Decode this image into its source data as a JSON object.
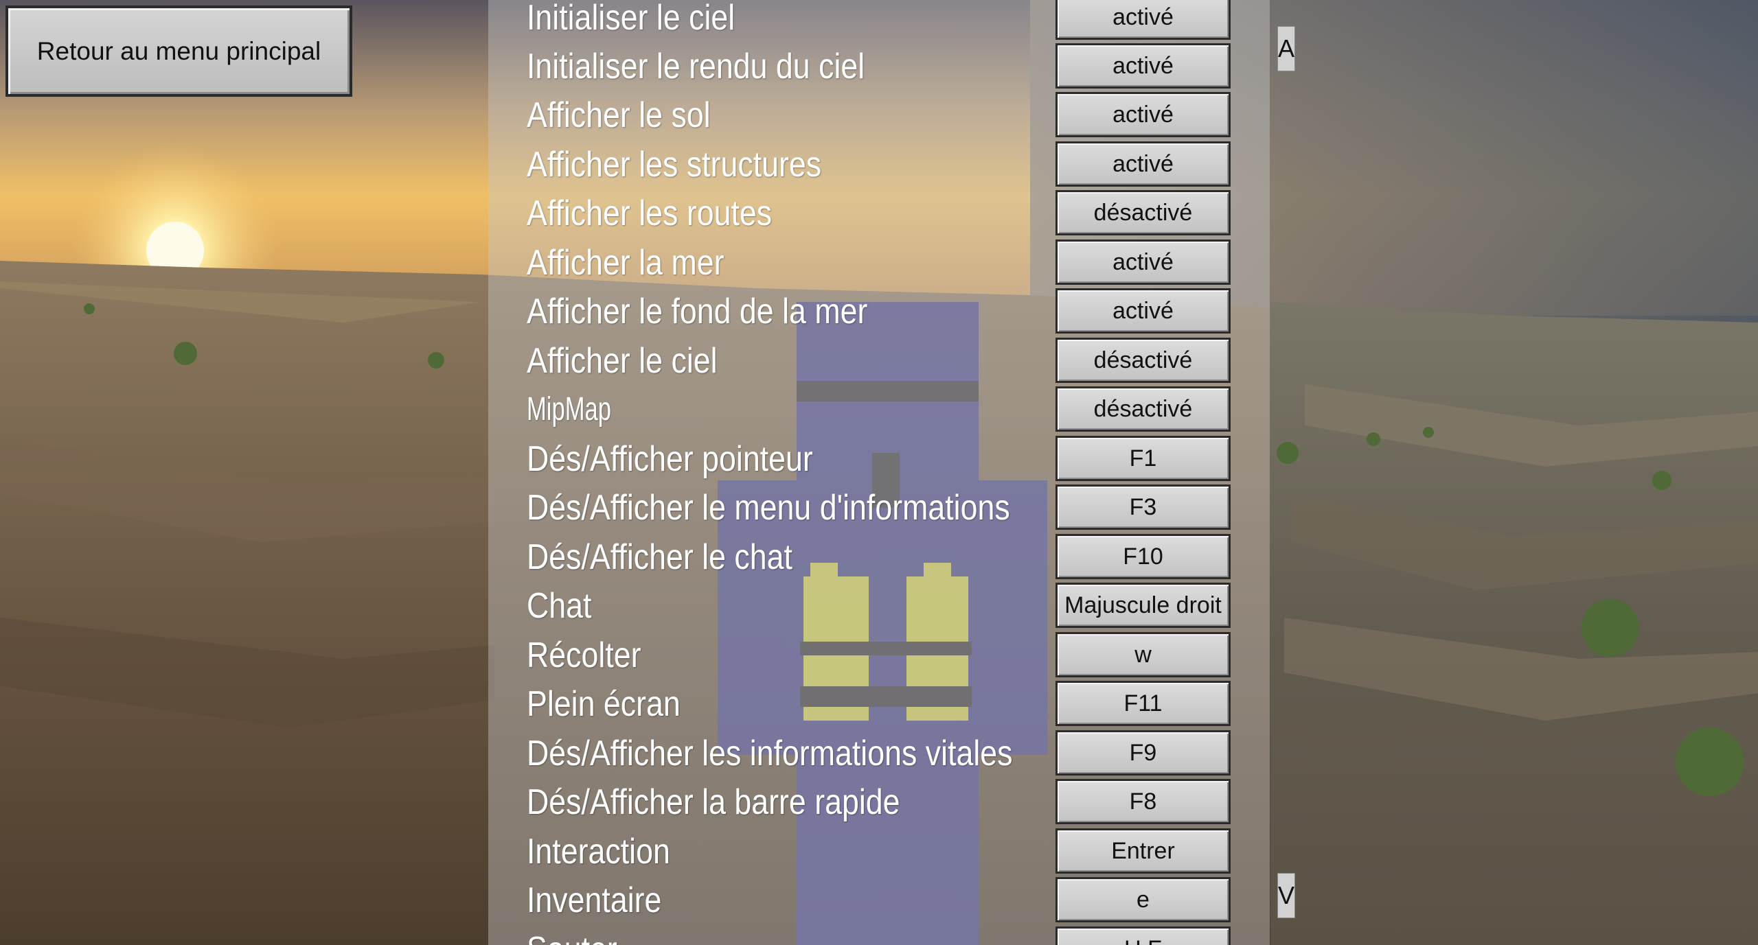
{
  "back_button": {
    "label": "Retour au menu principal"
  },
  "settings": [
    {
      "label": "Initialiser le ciel",
      "value": "activé"
    },
    {
      "label": "Initialiser le rendu du ciel",
      "value": "activé"
    },
    {
      "label": "Afficher le sol",
      "value": "activé"
    },
    {
      "label": "Afficher les structures",
      "value": "activé"
    },
    {
      "label": "Afficher les routes",
      "value": "désactivé"
    },
    {
      "label": "Afficher la mer",
      "value": "activé"
    },
    {
      "label": "Afficher le fond de la mer",
      "value": "activé"
    },
    {
      "label": "Afficher le ciel",
      "value": "désactivé"
    },
    {
      "label": "MipMap",
      "value": "désactivé"
    },
    {
      "label": "Dés/Afficher pointeur",
      "value": "F1"
    },
    {
      "label": "Dés/Afficher le menu d'informations",
      "value": "F3"
    },
    {
      "label": "Dés/Afficher le chat",
      "value": "F10"
    },
    {
      "label": "Chat",
      "value": "Majuscule droit"
    },
    {
      "label": "Récolter",
      "value": "w"
    },
    {
      "label": "Plein écran",
      "value": "F11"
    },
    {
      "label": "Dés/Afficher les informations vitales",
      "value": "F9"
    },
    {
      "label": "Dés/Afficher la barre rapide",
      "value": "F8"
    },
    {
      "label": "Interaction",
      "value": "Entrer"
    },
    {
      "label": "Inventaire",
      "value": "e"
    },
    {
      "label": "Sauter",
      "value": "U F"
    }
  ],
  "scrollbar": {
    "up_label": "A",
    "down_label": "V"
  },
  "colors": {
    "panel_overlay": "rgba(200,200,200,0.42)",
    "button_face": "#c8c8c8",
    "label_text": "#ffffff"
  }
}
